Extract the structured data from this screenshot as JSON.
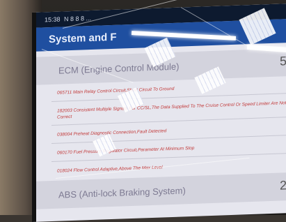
{
  "status_bar": {
    "time": "15:38",
    "icons_text": "N 8 8 8 ...",
    "right_text": ""
  },
  "header": {
    "title": "System and F"
  },
  "ecus": [
    {
      "name": "ECM (Engine Control Module)",
      "count": "5",
      "dtcs": [
        "065711 Main Relay Control Circuit,Short Circuit To Ground",
        "182003 Consistent Multiple Signals For CC/SL,The Data Supplied To The Cruise Control Or Speed Limiter Are Not Correct",
        "038004 Preheat Diagnostic Connection,Fault Detected",
        "060170 Fuel Pressure Regulator Circuit,Parameter At Minimum Stop",
        "018024 Flow Control Adaptive,Above The Max Level"
      ]
    },
    {
      "name": "ABS (Anti-lock Braking System)",
      "count": "2",
      "dtcs": []
    }
  ]
}
